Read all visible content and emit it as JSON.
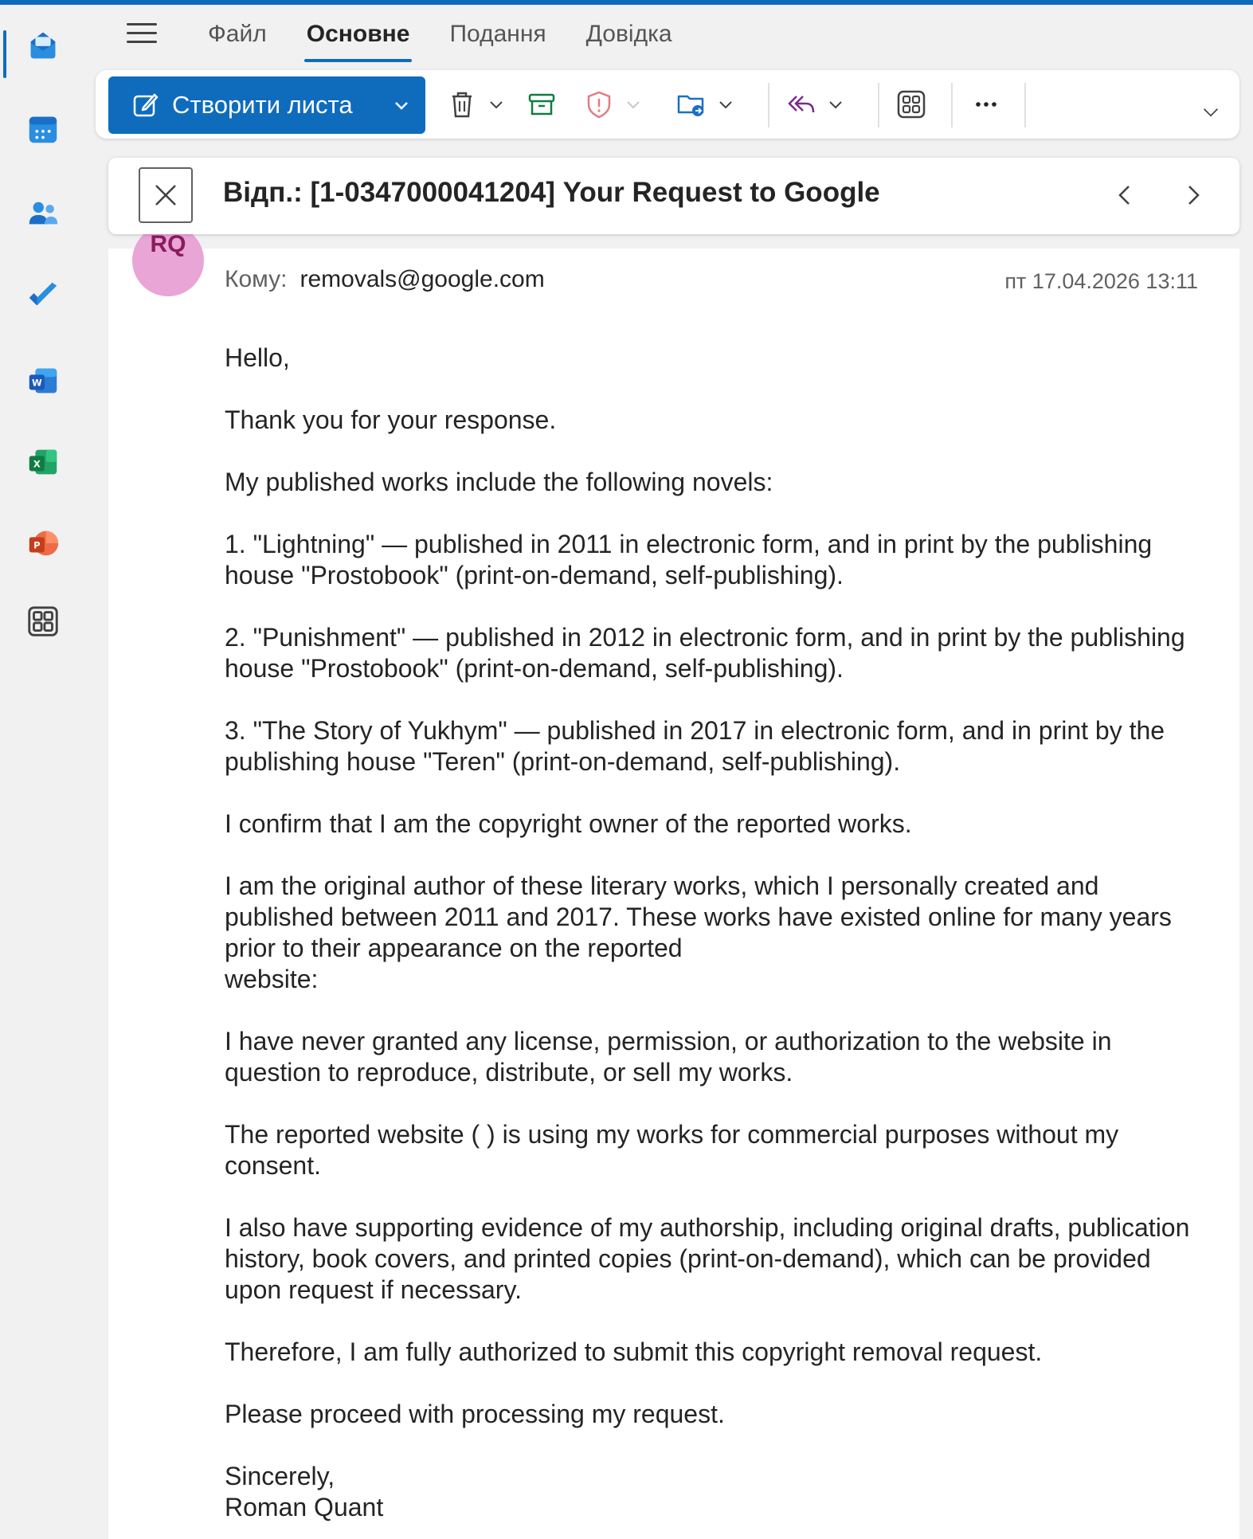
{
  "menu": {
    "tabs": [
      {
        "label": "Файл"
      },
      {
        "label": "Основне"
      },
      {
        "label": "Подання"
      },
      {
        "label": "Довідка"
      }
    ]
  },
  "ribbon": {
    "new_mail_label": "Створити листа",
    "icons": [
      "delete-icon",
      "archive-icon",
      "report-icon",
      "move-icon",
      "reply-all-icon",
      "apps-icon",
      "more-icon"
    ],
    "accent": "#0f6cbd"
  },
  "rail": {
    "icons": [
      "mail-icon",
      "calendar-icon",
      "people-icon",
      "todo-icon",
      "word-icon",
      "excel-icon",
      "powerpoint-icon",
      "apps-icon"
    ]
  },
  "message": {
    "subject": "Відп.: [1-0347000041204] Your Request to Google",
    "avatar_initials": "RQ",
    "to_label": "Кому:",
    "to_value": "removals@google.com",
    "date": "пт 17.04.2026 13:11",
    "body": [
      "Hello,",
      "Thank you for your response.",
      "My published works include the following novels:",
      "1. \"Lightning\" — published in 2011 in electronic form, and in print by the publishing house \"Prostobook\" (print-on-demand, self-publishing).",
      "2. \"Punishment\" — published in 2012 in electronic form, and in print by the publishing house \"Prostobook\" (print-on-demand, self-publishing).",
      "3. \"The Story of Yukhym\" — published in 2017 in electronic form, and in print by the publishing house \"Teren\" (print-on-demand, self-publishing).",
      "I confirm that I am the copyright owner of the reported works.",
      "I am the original author of these literary works, which I personally created and published between 2011 and 2017. These works have existed online for many years prior to their appearance on the reported\nwebsite:",
      "I have never granted any license, permission, or authorization to the website in question to reproduce, distribute, or sell my works.",
      "The reported website (                                              ) is using my works for commercial purposes without my consent.",
      "I also have supporting evidence of my authorship, including original drafts, publication history, book covers, and printed copies (print-on-demand), which can be provided upon request if necessary.",
      "Therefore, I am fully authorized to submit this copyright removal request.",
      "Please proceed with processing my request."
    ],
    "signoff": "Sincerely,",
    "signature": "Roman Quant"
  }
}
